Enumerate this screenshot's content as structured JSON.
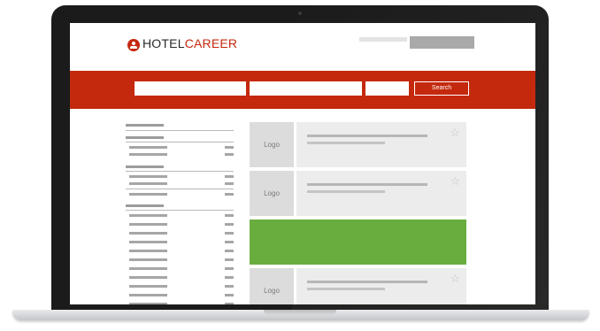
{
  "header": {
    "logo_part1": "HOTEL",
    "logo_part2": "CAREER"
  },
  "search": {
    "button_label": "Search"
  },
  "results": [
    {
      "logo_label": "Logo"
    },
    {
      "logo_label": "Logo"
    },
    {
      "logo_label": "Logo"
    }
  ],
  "colors": {
    "brand": "#c4290e",
    "featured": "#69ad3f",
    "frame": "#1b1b1b"
  },
  "icons": {
    "logo": "hotelcareer-logo-icon",
    "favorite": "star-outline-icon"
  }
}
